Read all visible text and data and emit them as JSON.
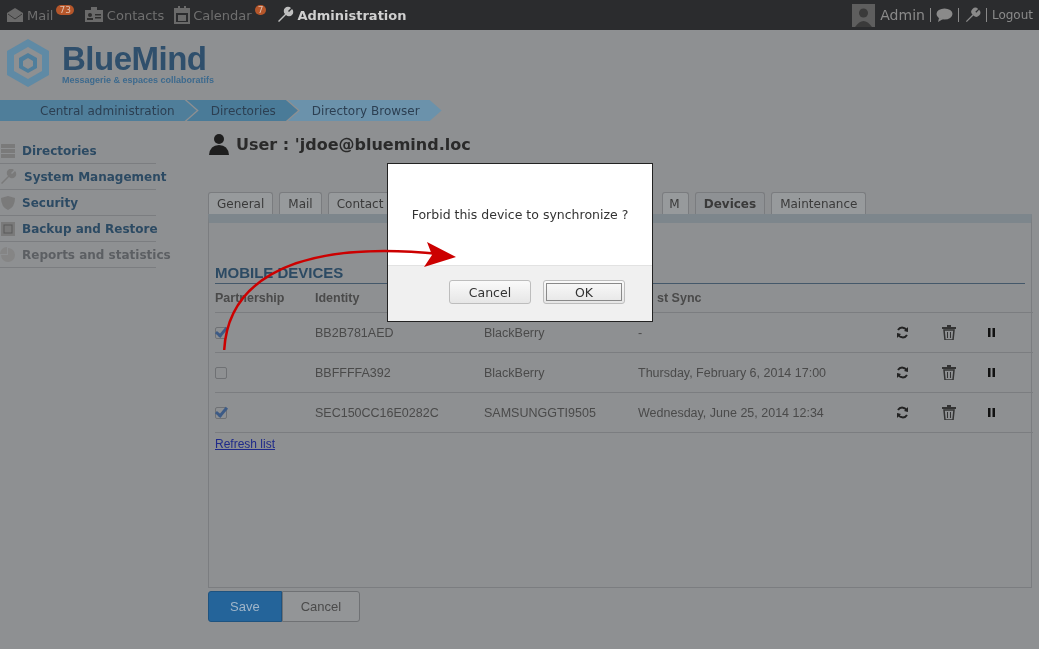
{
  "topbar": {
    "apps": [
      {
        "label": "Mail",
        "badge": "73",
        "selected": false
      },
      {
        "label": "Contacts",
        "selected": false
      },
      {
        "label": "Calendar",
        "badge": "7",
        "selected": false
      },
      {
        "label": "Administration",
        "selected": true
      }
    ],
    "user": "Admin",
    "logout": "Logout"
  },
  "logo": {
    "name": "BlueMind",
    "tagline": "Messagerie & espaces collaboratifs"
  },
  "breadcrumb": [
    "Central administration",
    "Directories",
    "Directory Browser"
  ],
  "sidebar": {
    "items": [
      {
        "label": "Directories",
        "disabled": false
      },
      {
        "label": "System Management",
        "disabled": false
      },
      {
        "label": "Security",
        "disabled": false
      },
      {
        "label": "Backup and Restore",
        "disabled": false
      },
      {
        "label": "Reports and statistics",
        "disabled": true
      }
    ]
  },
  "page_title": "User : 'jdoe@bluemind.loc",
  "tabs": [
    {
      "label": "General",
      "selected": false
    },
    {
      "label": "Mail",
      "selected": false
    },
    {
      "label": "Contact",
      "selected": false
    },
    {
      "label": "M",
      "selected": false
    },
    {
      "label": "Devices",
      "selected": true
    },
    {
      "label": "Maintenance",
      "selected": false
    }
  ],
  "section_title": "MOBILE DEVICES",
  "table": {
    "columns": [
      "Partnership",
      "Identity",
      "st Sync"
    ],
    "rows": [
      {
        "partnership": true,
        "identity": "BB2B781AED",
        "column_3": "BlackBerry",
        "last_sync": "-"
      },
      {
        "partnership": false,
        "identity": "BBFFFFA392",
        "column_3": "BlackBerry",
        "last_sync": "Thursday, February 6, 2014 17:00"
      },
      {
        "partnership": true,
        "identity": "SEC150CC16E0282C",
        "column_3": "SAMSUNGGTI9505",
        "last_sync": "Wednesday, June 25, 2014 12:34"
      }
    ]
  },
  "refresh_link": "Refresh list",
  "buttons": [
    {
      "label": "Save",
      "kind": "primary"
    },
    {
      "label": "Cancel",
      "kind": "default"
    }
  ],
  "dialog": {
    "message": "Forbid this device to synchronize ?",
    "buttons": [
      {
        "label": "Cancel",
        "focused": false
      },
      {
        "label": "OK",
        "focused": true
      }
    ]
  }
}
